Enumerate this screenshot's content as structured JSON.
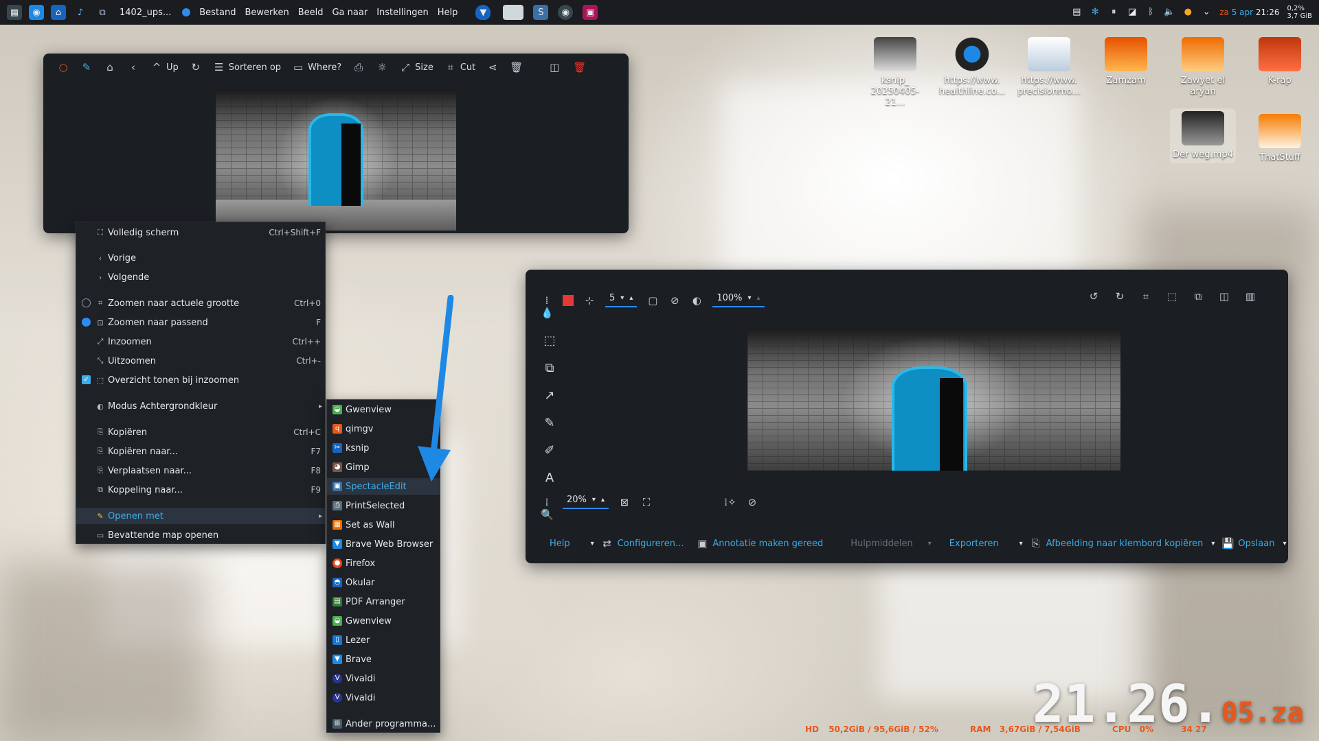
{
  "taskbar": {
    "window_title": "1402_ups...",
    "menu": [
      "Bestand",
      "Bewerken",
      "Beeld",
      "Ga naar",
      "Instellingen",
      "Help"
    ],
    "tray": {
      "cpu": "0,2%",
      "mem": "3,7 GiB",
      "day": "za",
      "date": "5 apr",
      "time": "21:26"
    }
  },
  "gwenview": {
    "toolbar": {
      "up": "Up",
      "sort": "Sorteren op",
      "where": "Where?",
      "size": "Size",
      "cut": "Cut"
    }
  },
  "context_menu": {
    "items": [
      {
        "label": "Volledig scherm",
        "shortcut": "Ctrl+Shift+F"
      },
      {
        "label": "Vorige",
        "shortcut": ""
      },
      {
        "label": "Volgende",
        "shortcut": ""
      },
      {
        "label": "Zoomen naar actuele grootte",
        "shortcut": "Ctrl+0"
      },
      {
        "label": "Zoomen naar passend",
        "shortcut": "F"
      },
      {
        "label": "Inzoomen",
        "shortcut": "Ctrl++"
      },
      {
        "label": "Uitzoomen",
        "shortcut": "Ctrl+-"
      },
      {
        "label": "Overzicht tonen bij inzoomen",
        "shortcut": ""
      },
      {
        "label": "Modus Achtergrondkleur",
        "shortcut": ""
      },
      {
        "label": "Kopiëren",
        "shortcut": "Ctrl+C"
      },
      {
        "label": "Kopiëren naar...",
        "shortcut": "F7"
      },
      {
        "label": "Verplaatsen naar...",
        "shortcut": "F8"
      },
      {
        "label": "Koppeling naar...",
        "shortcut": "F9"
      },
      {
        "label": "Openen met",
        "shortcut": ""
      },
      {
        "label": "Bevattende map openen",
        "shortcut": ""
      }
    ]
  },
  "open_with": {
    "items": [
      "Gwenview",
      "qimgv",
      "ksnip",
      "Gimp",
      "SpectacleEdit",
      "PrintSelected",
      "Set as Wall",
      "Brave Web Browser",
      "Firefox",
      "Okular",
      "PDF Arranger",
      "Gwenview",
      "Lezer",
      "Brave",
      "Vivaldi",
      "Vivaldi",
      "Ander programma..."
    ],
    "highlighted": "SpectacleEdit"
  },
  "desktop_icons": [
    {
      "label": "ksnip_ 20250405-21..."
    },
    {
      "label": "https://www. healthline.co..."
    },
    {
      "label": "https://www. precisionmo..."
    },
    {
      "label": "Zamzam"
    },
    {
      "label": "Zawyet el aryan"
    },
    {
      "label": "K-rap"
    },
    {
      "label": "Der weg.mp4"
    },
    {
      "label": "ThatStuff"
    }
  ],
  "spectacle": {
    "stroke_width": "5",
    "opacity": "100%",
    "zoom": "20%",
    "footer": {
      "help": "Help",
      "configure": "Configureren...",
      "annotate_done": "Annotatie maken gereed",
      "tools": "Hulpmiddelen",
      "export": "Exporteren",
      "copy_clipboard": "Afbeelding naar klembord kopiëren",
      "save": "Opslaan"
    }
  },
  "sysstats": {
    "hd_label": "HD",
    "hd_value": "50,2GiB / 95,6GiB / 52%",
    "ram_label": "RAM",
    "ram_value": "3,67GiB / 7,54GiB",
    "cpu_label": "CPU",
    "cpu_value": "0%",
    "temp_value": "34",
    "temp_max": "27"
  },
  "clock": {
    "hhmm": "21.26.",
    "day": "05.",
    "dow": "za"
  },
  "colors": {
    "accent": "#3daee9",
    "highlight": "#2e8bef",
    "arrow": "#1e88e5",
    "stat_label": "#e8571c"
  }
}
